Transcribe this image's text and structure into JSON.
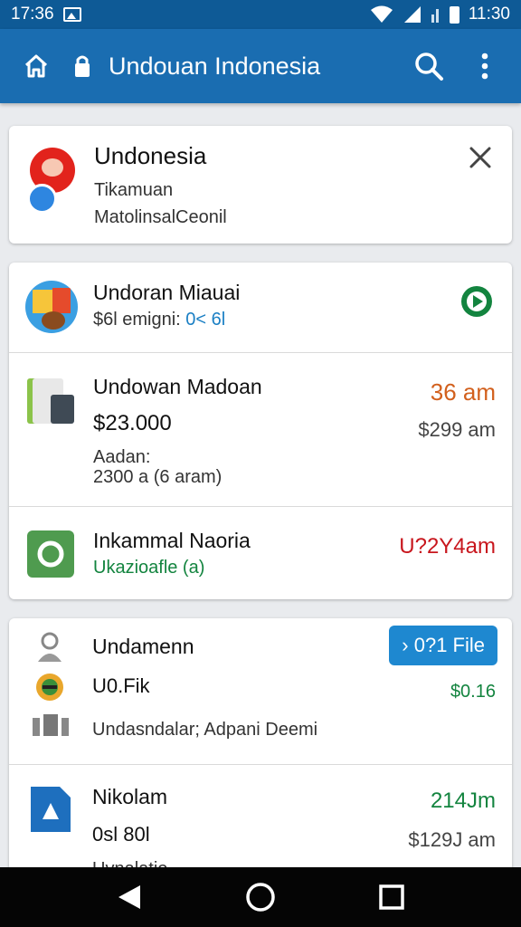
{
  "status_bar": {
    "time": "17:36",
    "right_time": "11:30"
  },
  "app_bar": {
    "title": "Undouan Indonesia",
    "icons": [
      "home-icon",
      "lock-icon",
      "search-icon",
      "more-vert-icon"
    ]
  },
  "header_card": {
    "title": "Undonesia",
    "line1": "Tikamuan",
    "line2": "MatolinsalCeonil"
  },
  "rows": [
    {
      "name": "Undoran Miauai",
      "sub": "$6l emigni: ",
      "sub_accent": "0< 6l"
    },
    {
      "name": "Undowan Madoan",
      "amount": "36 am",
      "price": "$23.000",
      "price_right": "$299 am",
      "note1": "Aadan:",
      "note2": "2300 a (6 aram)"
    },
    {
      "name": "Inkammal Naoria",
      "sub": "Ukazioafle (a)",
      "amount": "U?2Y4am"
    }
  ],
  "file_card": {
    "row1": {
      "name": "Undamenn",
      "button": "› 0?1 File",
      "sub": "U0.Fik",
      "amount": "$0.16",
      "note": "Undasndalar; Adpani Deemi"
    },
    "row2": {
      "name": "Nikolam",
      "sub": "0sl 80l",
      "amount": "214Jm",
      "price_right": "$129J am",
      "note": "Uvnalatio"
    }
  },
  "colors": {
    "status_bar": "#0e5a96",
    "app_bar": "#1a6db1",
    "orange": "#d2601d",
    "red": "#c8161d",
    "green": "#13843f",
    "button": "#1e88d0"
  }
}
